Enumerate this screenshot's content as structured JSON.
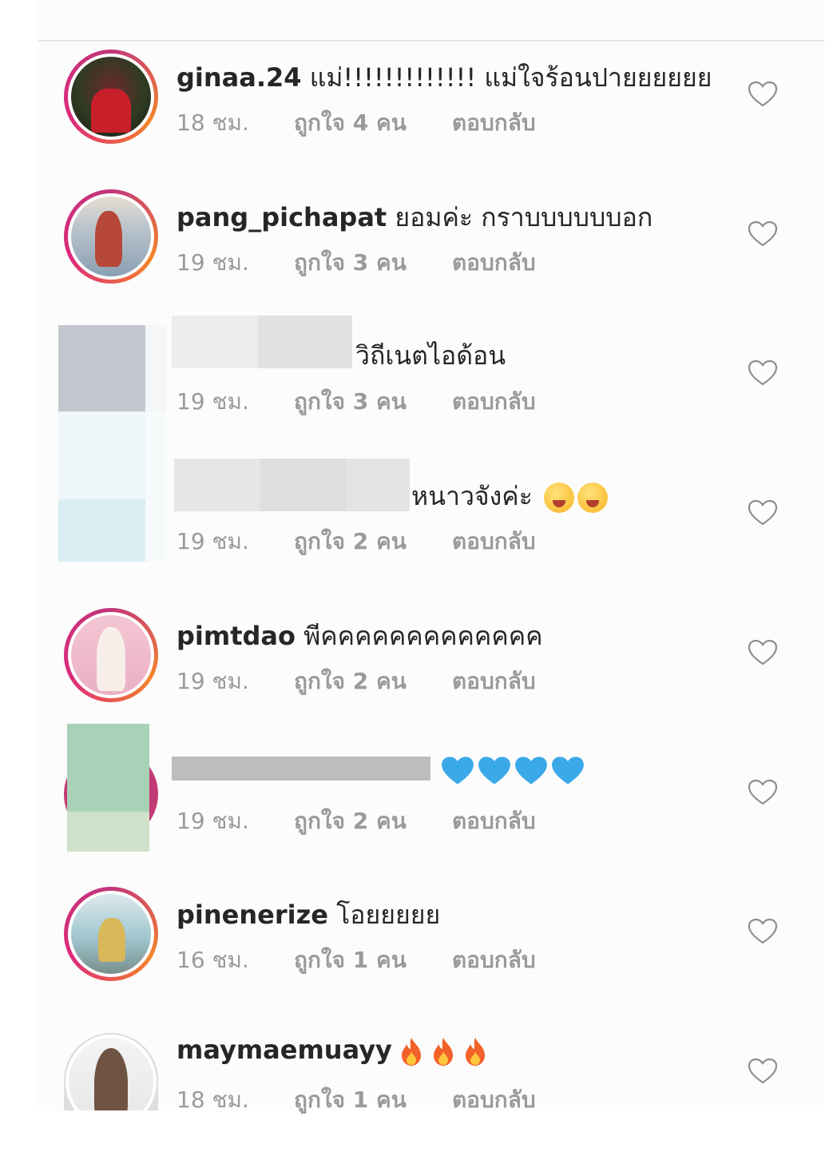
{
  "comments": [
    {
      "username": "ginaa.24",
      "text": "แม่!!!!!!!!!!!!! แม่ใจร้อนปายยยยยย",
      "time": "18 ชม.",
      "likes": "ถูกใจ 4 คน",
      "reply": "ตอบกลับ",
      "avatar_ring": "story"
    },
    {
      "username": "pang_pichapat",
      "text": "ยอมค่ะ กราบบบบบบอก",
      "time": "19 ชม.",
      "likes": "ถูกใจ 3 คน",
      "reply": "ตอบกลับ",
      "avatar_ring": "story"
    },
    {
      "username": "",
      "text": "วิถีเนตไอด้อน",
      "time": "19 ชม.",
      "likes": "ถูกใจ 3 คน",
      "reply": "ตอบกลับ",
      "avatar_ring": "blurred"
    },
    {
      "username": "",
      "text": "หนาวจังค่ะ",
      "emoji": "face-blowing-kiss",
      "time": "19 ชม.",
      "likes": "ถูกใจ 2 คน",
      "reply": "ตอบกลับ",
      "avatar_ring": "blurred"
    },
    {
      "username": "pimtdao",
      "text": "พีคคคคคคคคคคคคค",
      "time": "19 ชม.",
      "likes": "ถูกใจ 2 คน",
      "reply": "ตอบกลับ",
      "avatar_ring": "story"
    },
    {
      "username": "",
      "text": "",
      "emoji": "blue-heart",
      "time": "19 ชม.",
      "likes": "ถูกใจ 2 คน",
      "reply": "ตอบกลับ",
      "avatar_ring": "blurred"
    },
    {
      "username": "pinenerize",
      "text": "โอยยยยย",
      "time": "16 ชม.",
      "likes": "ถูกใจ 1 คน",
      "reply": "ตอบกลับ",
      "avatar_ring": "story"
    },
    {
      "username": "maymaemuayy",
      "text": "",
      "emoji": "fire",
      "time": "18 ชม.",
      "likes": "ถูกใจ 1 คน",
      "reply": "ตอบกลับ",
      "avatar_ring": "plain"
    }
  ],
  "colors": {
    "text": "#262626",
    "meta": "#9a9a9a",
    "ring_gradient": [
      "#c1357c",
      "#f58529",
      "#dd2a7b"
    ],
    "heart_outline": "#8e8e8e",
    "blue_heart": "#3aa9e8",
    "fire": "#f2612a"
  },
  "icons": {
    "like": "heart-outline-icon"
  }
}
